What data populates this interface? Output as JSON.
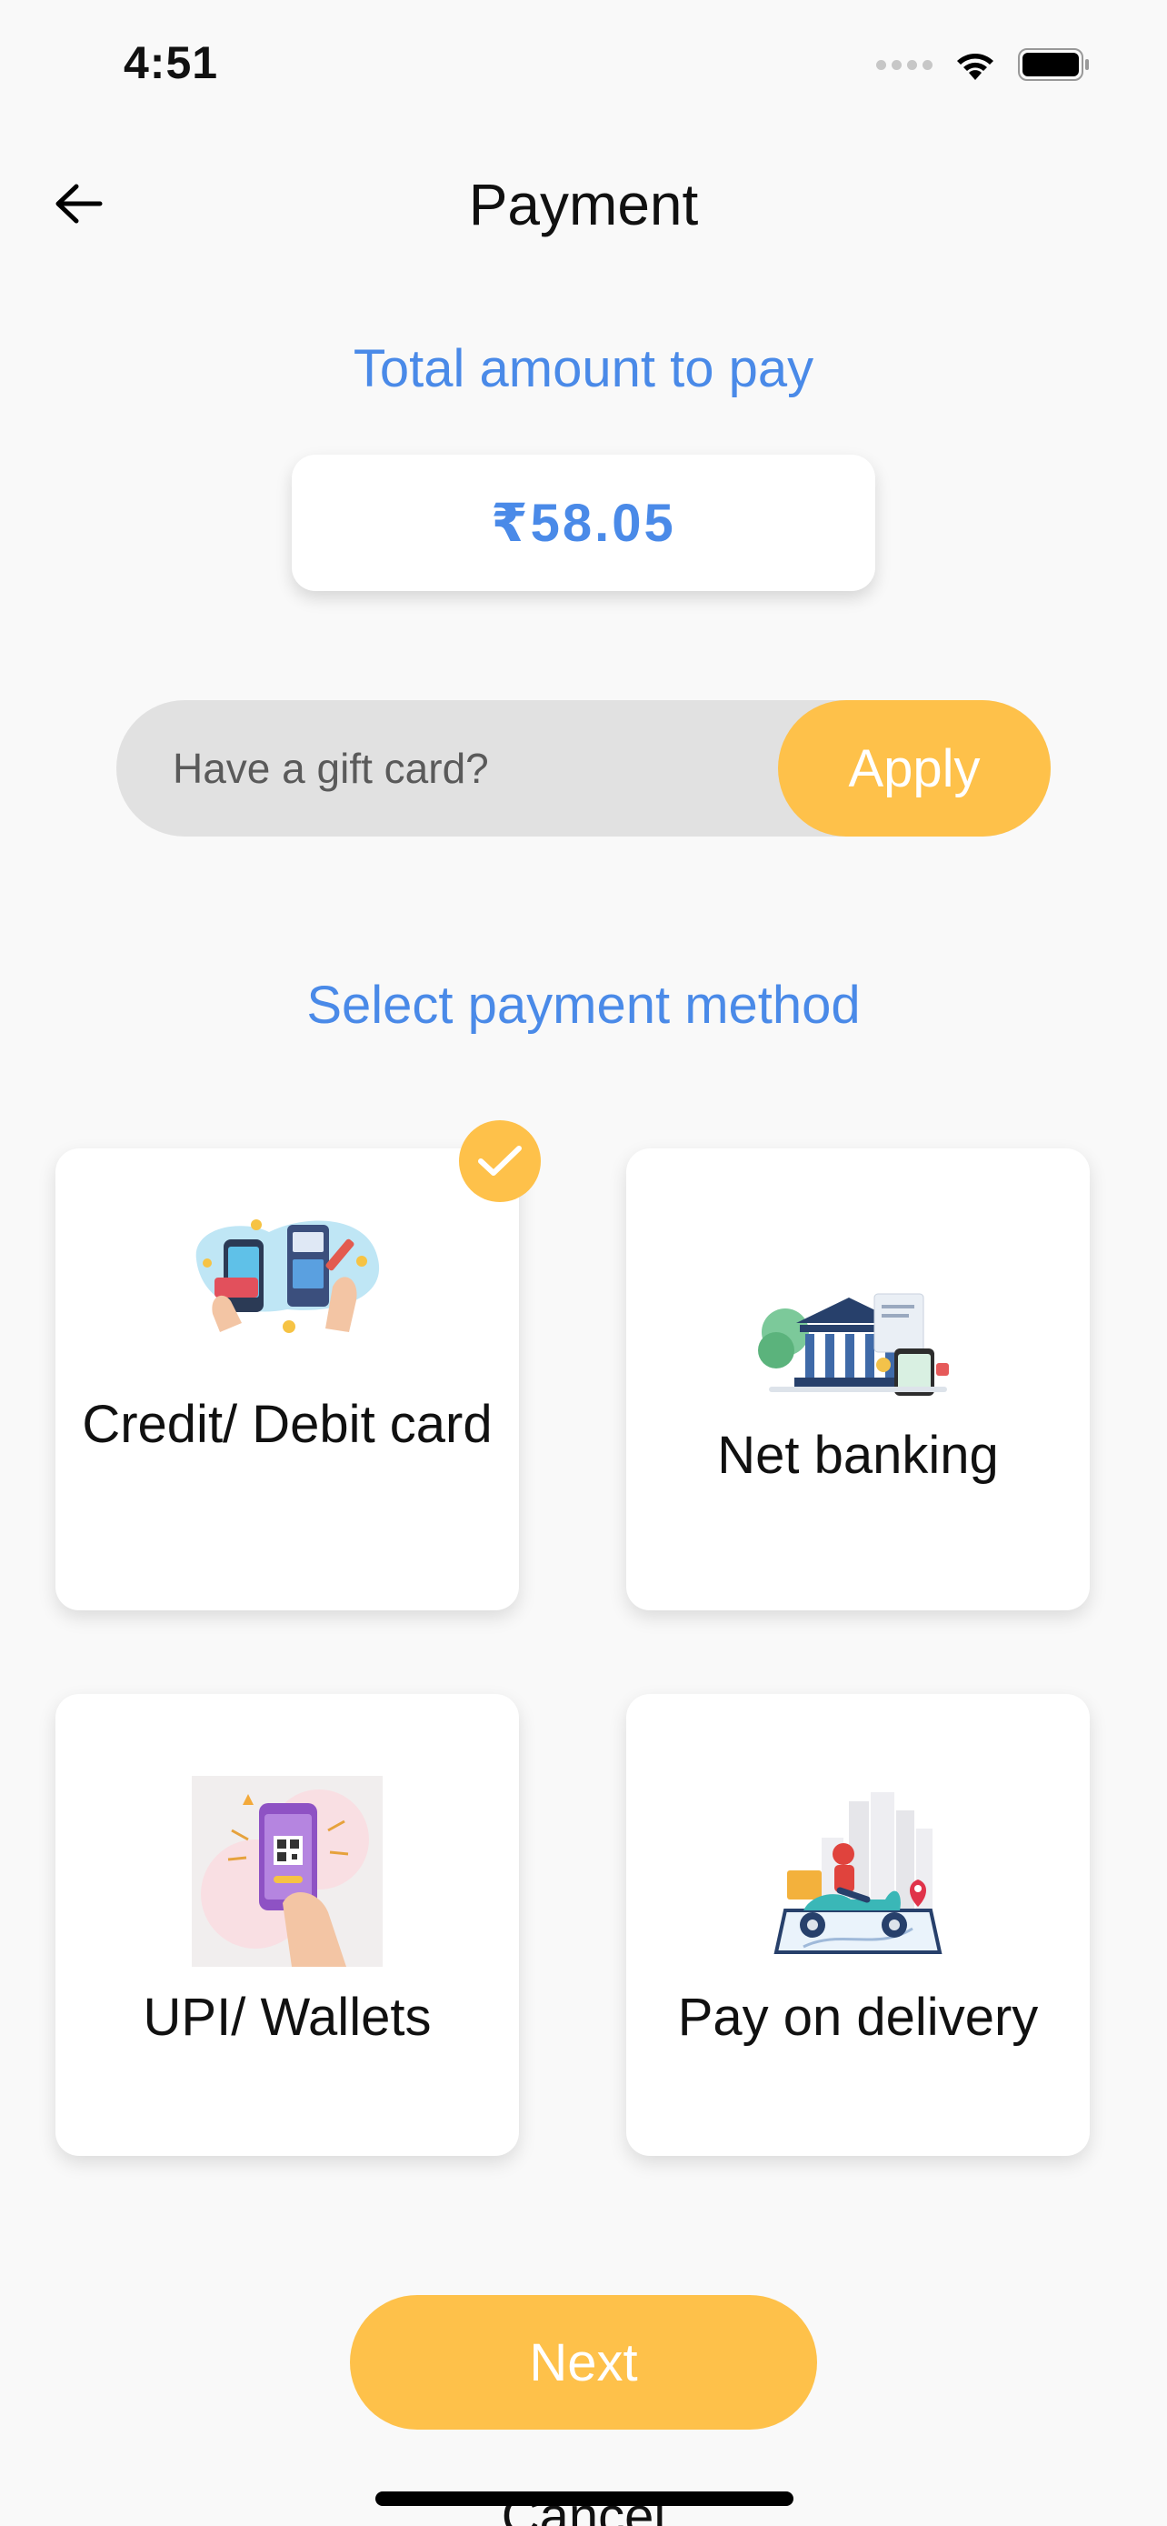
{
  "status_bar": {
    "time": "4:51"
  },
  "header": {
    "title": "Payment"
  },
  "amount": {
    "heading": "Total amount to pay",
    "value": "₹58.05"
  },
  "gift_card": {
    "placeholder": "Have a gift card?",
    "apply_label": "Apply"
  },
  "methods": {
    "heading": "Select payment method",
    "items": [
      {
        "label": "Credit/ Debit card",
        "selected": true
      },
      {
        "label": "Net banking",
        "selected": false
      },
      {
        "label": "UPI/ Wallets",
        "selected": false
      },
      {
        "label": "Pay on delivery",
        "selected": false
      }
    ]
  },
  "actions": {
    "next_label": "Next",
    "cancel_label": "Cancel"
  },
  "colors": {
    "accent_blue": "#4a8ae8",
    "accent_yellow": "#fec14a",
    "background": "#f9f9f9"
  }
}
